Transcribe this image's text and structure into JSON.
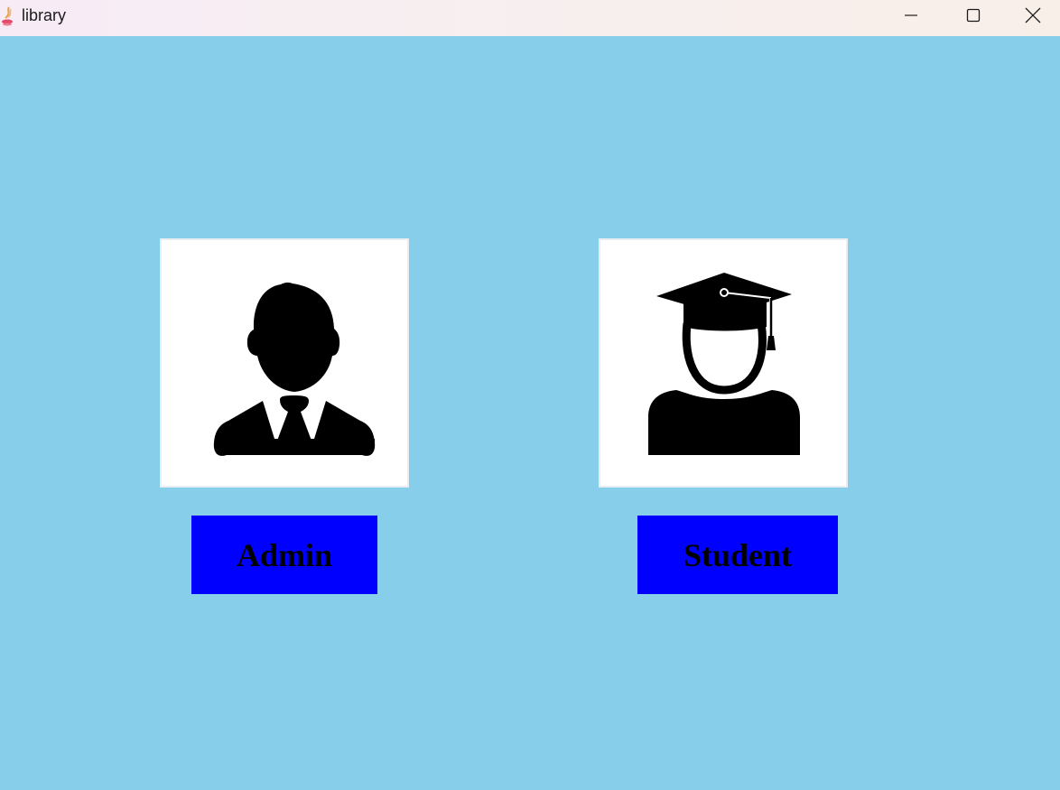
{
  "window": {
    "title": "library",
    "app_icon": "java-coffee-icon",
    "controls": [
      "minimize-icon",
      "maximize-icon",
      "close-icon"
    ]
  },
  "colors": {
    "background": "#87ceea",
    "button": "#0000ff",
    "button_text": "#000000",
    "card": "#ffffff"
  },
  "roles": {
    "admin": {
      "icon": "admin-person-icon",
      "label": "Admin"
    },
    "student": {
      "icon": "graduate-student-icon",
      "label": "Student"
    }
  }
}
